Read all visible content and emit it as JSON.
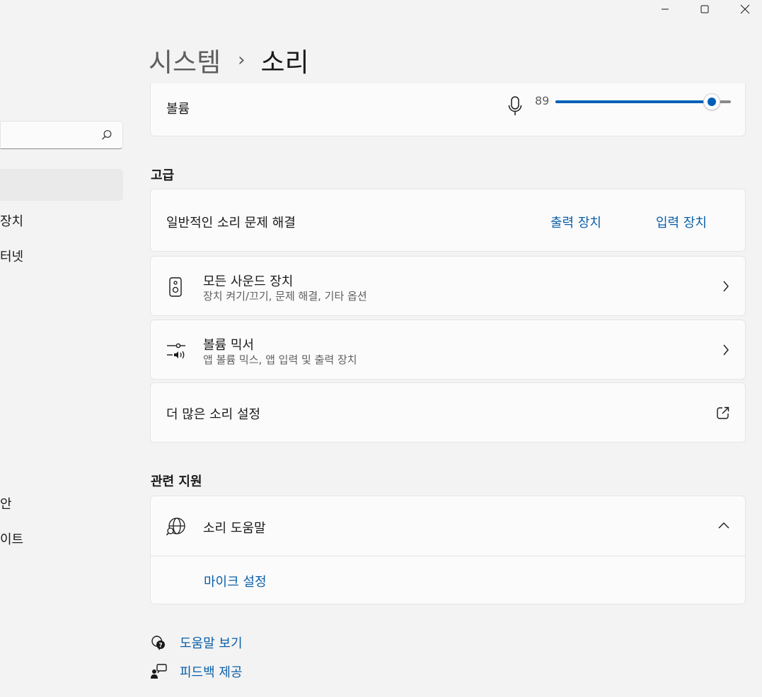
{
  "breadcrumb": {
    "parent": "시스템",
    "separator": "›",
    "current": "소리"
  },
  "sidebar": {
    "fragments": [
      "장치",
      "터넷",
      "안",
      "이트"
    ]
  },
  "volume": {
    "label": "볼륨",
    "value": "89",
    "level_percent": 89
  },
  "advanced": {
    "title": "고급",
    "troubleshoot": {
      "label": "일반적인 소리 문제 해결",
      "output_link": "출력 장치",
      "input_link": "입력 장치"
    },
    "all_devices": {
      "title": "모든 사운드 장치",
      "subtitle": "장치 켜기/끄기, 문제 해결, 기타 옵션"
    },
    "mixer": {
      "title": "볼륨 믹서",
      "subtitle": "앱 볼륨 믹스, 앱 입력 및 출력 장치"
    },
    "more_settings": {
      "label": "더 많은 소리 설정"
    }
  },
  "related": {
    "title": "관련 지원",
    "help": {
      "label": "소리 도움말",
      "link": "마이크 설정"
    }
  },
  "footer": {
    "get_help": "도움말 보기",
    "feedback": "피드백 제공"
  }
}
